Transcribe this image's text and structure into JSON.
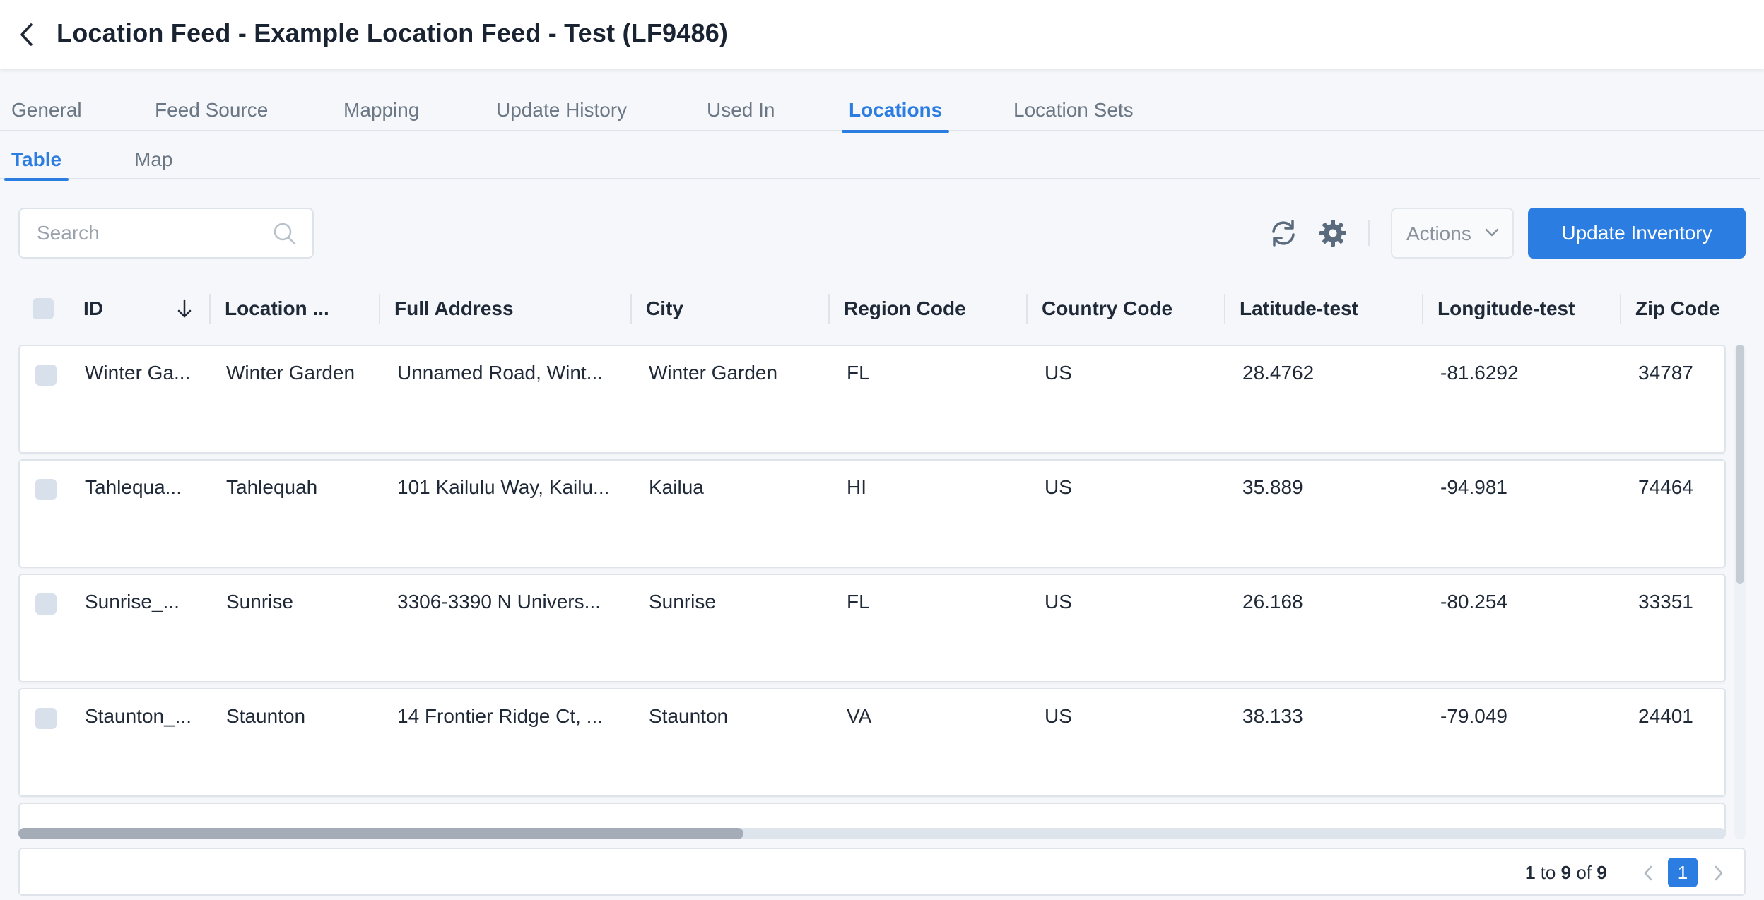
{
  "header": {
    "title": "Location Feed - Example Location Feed - Test (LF9486)"
  },
  "main_tabs": [
    {
      "label": "General"
    },
    {
      "label": "Feed Source"
    },
    {
      "label": "Mapping"
    },
    {
      "label": "Update History"
    },
    {
      "label": "Used In"
    },
    {
      "label": "Locations",
      "active": true
    },
    {
      "label": "Location Sets"
    }
  ],
  "sub_tabs": [
    {
      "label": "Table",
      "active": true
    },
    {
      "label": "Map"
    }
  ],
  "toolbar": {
    "search_placeholder": "Search",
    "actions_label": "Actions",
    "update_label": "Update Inventory"
  },
  "table": {
    "columns": [
      "ID",
      "Location ...",
      "Full Address",
      "City",
      "Region Code",
      "Country Code",
      "Latitude-test",
      "Longitude-test",
      "Zip Code"
    ],
    "sort": {
      "column": "ID",
      "direction": "descending"
    },
    "rows": [
      {
        "id": "Winter Ga...",
        "location": "Winter Garden",
        "address": "Unnamed Road, Wint...",
        "city": "Winter Garden",
        "region": "FL",
        "country": "US",
        "lat": "28.4762",
        "lng": "-81.6292",
        "zip": "34787"
      },
      {
        "id": "Tahlequa...",
        "location": "Tahlequah",
        "address": "101 Kailulu Way, Kailu...",
        "city": "Kailua",
        "region": "HI",
        "country": "US",
        "lat": "35.889",
        "lng": "-94.981",
        "zip": "74464"
      },
      {
        "id": "Sunrise_...",
        "location": "Sunrise",
        "address": "3306-3390 N Univers...",
        "city": "Sunrise",
        "region": "FL",
        "country": "US",
        "lat": "26.168",
        "lng": "-80.254",
        "zip": "33351"
      },
      {
        "id": "Staunton_...",
        "location": "Staunton",
        "address": "14 Frontier Ridge Ct, ...",
        "city": "Staunton",
        "region": "VA",
        "country": "US",
        "lat": "38.133",
        "lng": "-79.049",
        "zip": "24401"
      }
    ]
  },
  "pagination": {
    "from": "1",
    "to_word": "to",
    "to": "9",
    "of_word": "of",
    "total": "9",
    "current_page": "1"
  },
  "colors": {
    "accent": "#2b7de1",
    "title": "#1a2332"
  }
}
